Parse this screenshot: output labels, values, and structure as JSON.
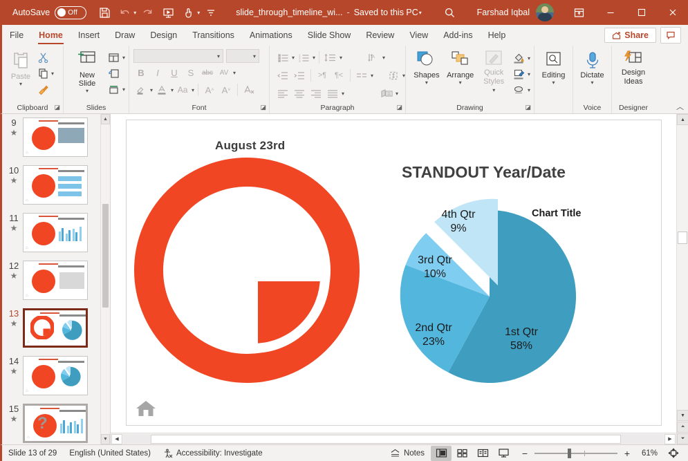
{
  "titlebar": {
    "autosave_label": "AutoSave",
    "autosave_state": "Off",
    "doc_name": "slide_through_timeline_wi...",
    "separator": "-",
    "saved_state": "Saved to this PC",
    "user_name": "Farshad Iqbal",
    "qat": [
      {
        "name": "save-icon",
        "tooltip": "Save"
      },
      {
        "name": "undo-icon",
        "tooltip": "Undo"
      },
      {
        "name": "redo-icon",
        "tooltip": "Redo"
      },
      {
        "name": "start-presentation-icon",
        "tooltip": "Start From Beginning"
      },
      {
        "name": "touch-mode-icon",
        "tooltip": "Touch/Mouse Mode"
      },
      {
        "name": "customize-qat-icon",
        "tooltip": "Customize Quick Access Toolbar"
      }
    ],
    "window_controls": {
      "ribbon_display": "Ribbon Display Options",
      "minimize": "Minimize",
      "maximize": "Restore Down",
      "close": "Close"
    }
  },
  "ribbon": {
    "tabs": [
      {
        "label": "File",
        "active": false
      },
      {
        "label": "Home",
        "active": true
      },
      {
        "label": "Insert",
        "active": false
      },
      {
        "label": "Draw",
        "active": false
      },
      {
        "label": "Design",
        "active": false
      },
      {
        "label": "Transitions",
        "active": false
      },
      {
        "label": "Animations",
        "active": false
      },
      {
        "label": "Slide Show",
        "active": false
      },
      {
        "label": "Review",
        "active": false
      },
      {
        "label": "View",
        "active": false
      },
      {
        "label": "Add-ins",
        "active": false
      },
      {
        "label": "Help",
        "active": false
      }
    ],
    "share_label": "Share",
    "comments_label": "Comments",
    "groups": {
      "clipboard": {
        "label": "Clipboard",
        "paste_label": "Paste",
        "cut_label": "Cut",
        "copy_label": "Copy",
        "format_painter_label": "Format Painter"
      },
      "slides": {
        "label": "Slides",
        "new_slide_label": "New Slide",
        "layout_label": "Layout",
        "reset_label": "Reset",
        "section_label": "Section"
      },
      "font": {
        "label": "Font",
        "font_name_value": "",
        "font_size_value": "",
        "bold": "B",
        "italic": "I",
        "underline": "U",
        "shadow": "S",
        "strikethrough": "abc",
        "char_spacing": "AV",
        "text_highlight": "Text Highlight Color",
        "font_color": "Font Color",
        "change_case": "Aa",
        "increase_size": "A",
        "decrease_size": "A",
        "clear_formatting": "Clear All Formatting"
      },
      "paragraph": {
        "label": "Paragraph",
        "bullets": "Bullets",
        "numbering": "Numbering",
        "line_spacing": "Line Spacing",
        "text_direction": "Text Direction",
        "decrease_indent": "Decrease List Level",
        "increase_indent": "Increase List Level",
        "rtl": "Right-to-Left",
        "ltr": "Left-to-Right",
        "align_text": "Align Text",
        "columns": "Columns",
        "convert_smartart": "Convert to SmartArt"
      },
      "drawing": {
        "label": "Drawing",
        "shapes_label": "Shapes",
        "arrange_label": "Arrange",
        "quick_styles_label": "Quick Styles",
        "shape_fill": "Shape Fill",
        "shape_outline": "Shape Outline",
        "shape_effects": "Shape Effects"
      },
      "editing": {
        "label": "",
        "editing_label": "Editing"
      },
      "voice": {
        "label": "Voice",
        "dictate_label": "Dictate"
      },
      "designer": {
        "label": "Designer",
        "design_ideas_label": "Design Ideas"
      }
    }
  },
  "thumbnails": [
    {
      "number": "9",
      "star": "★",
      "selected": false,
      "hovered": false
    },
    {
      "number": "10",
      "star": "★",
      "selected": false,
      "hovered": false
    },
    {
      "number": "11",
      "star": "★",
      "selected": false,
      "hovered": false
    },
    {
      "number": "12",
      "star": "★",
      "selected": false,
      "hovered": false
    },
    {
      "number": "13",
      "star": "★",
      "selected": true,
      "hovered": false
    },
    {
      "number": "14",
      "star": "★",
      "selected": false,
      "hovered": false
    },
    {
      "number": "15",
      "star": "★",
      "selected": false,
      "hovered": true
    }
  ],
  "slide": {
    "left_title": "August 23rd",
    "right_title": "STANDOUT Year/Date",
    "home_icon": "home-icon"
  },
  "chart_data": {
    "type": "pie",
    "title": "Chart Title",
    "categories": [
      "1st Qtr",
      "2nd Qtr",
      "3rd Qtr",
      "4th Qtr"
    ],
    "values": [
      58,
      23,
      10,
      9
    ],
    "value_suffix": "%",
    "labels": [
      {
        "name": "1st Qtr",
        "value": "58%"
      },
      {
        "name": "2nd Qtr",
        "value": "23%"
      },
      {
        "name": "3rd Qtr",
        "value": "10%"
      },
      {
        "name": "4th Qtr",
        "value": "9%"
      }
    ],
    "colors": [
      "#3f9ec0",
      "#53b6dd",
      "#7fcdf0",
      "#bfe5f7"
    ],
    "exploded_slice": "4th Qtr",
    "legend": "none",
    "grid": false
  },
  "statusbar": {
    "slide_counter": "Slide 13 of 29",
    "language": "English (United States)",
    "accessibility": "Accessibility: Investigate",
    "notes_label": "Notes",
    "views": [
      {
        "name": "normal-view",
        "label": "Normal",
        "active": true
      },
      {
        "name": "slide-sorter-view",
        "label": "Slide Sorter",
        "active": false
      },
      {
        "name": "reading-view",
        "label": "Reading View",
        "active": false
      },
      {
        "name": "slide-show-view",
        "label": "Slide Show",
        "active": false
      }
    ],
    "zoom_out": "−",
    "zoom_in": "+",
    "zoom_level": "61%",
    "fit_label": "Fit slide to current window"
  },
  "colors": {
    "brand": "#b7472a",
    "accent_red": "#f04624",
    "chart_primary": "#3f9ec0"
  }
}
